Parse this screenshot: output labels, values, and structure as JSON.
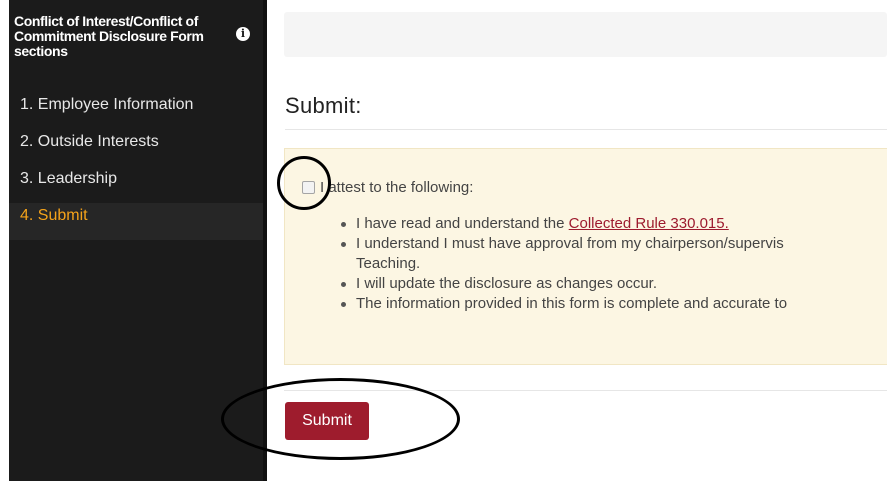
{
  "sidebar": {
    "header": "Conflict of Interest/Conflict of Commitment Disclosure Form sections",
    "info_icon": "i",
    "items": [
      {
        "label": "1.  Employee Information"
      },
      {
        "label": "2.  Outside Interests"
      },
      {
        "label": "3.  Leadership"
      },
      {
        "label": "4.  Submit"
      }
    ],
    "active_color": "#f5a31a"
  },
  "main": {
    "heading": "Submit:",
    "attest_label": "I attest to the following:",
    "attest_checked": false,
    "bullets": {
      "b1_prefix": "I have read and understand the ",
      "b1_link": "Collected Rule 330.015.",
      "b2_line1": "I understand I must have approval from my chairperson/supervis",
      "b2_line2": "Teaching.",
      "b3": "I will update the disclosure as changes occur.",
      "b4": "The information provided in this form is complete and accurate to"
    },
    "submit_label": "Submit",
    "submit_color": "#9e1c2d"
  }
}
